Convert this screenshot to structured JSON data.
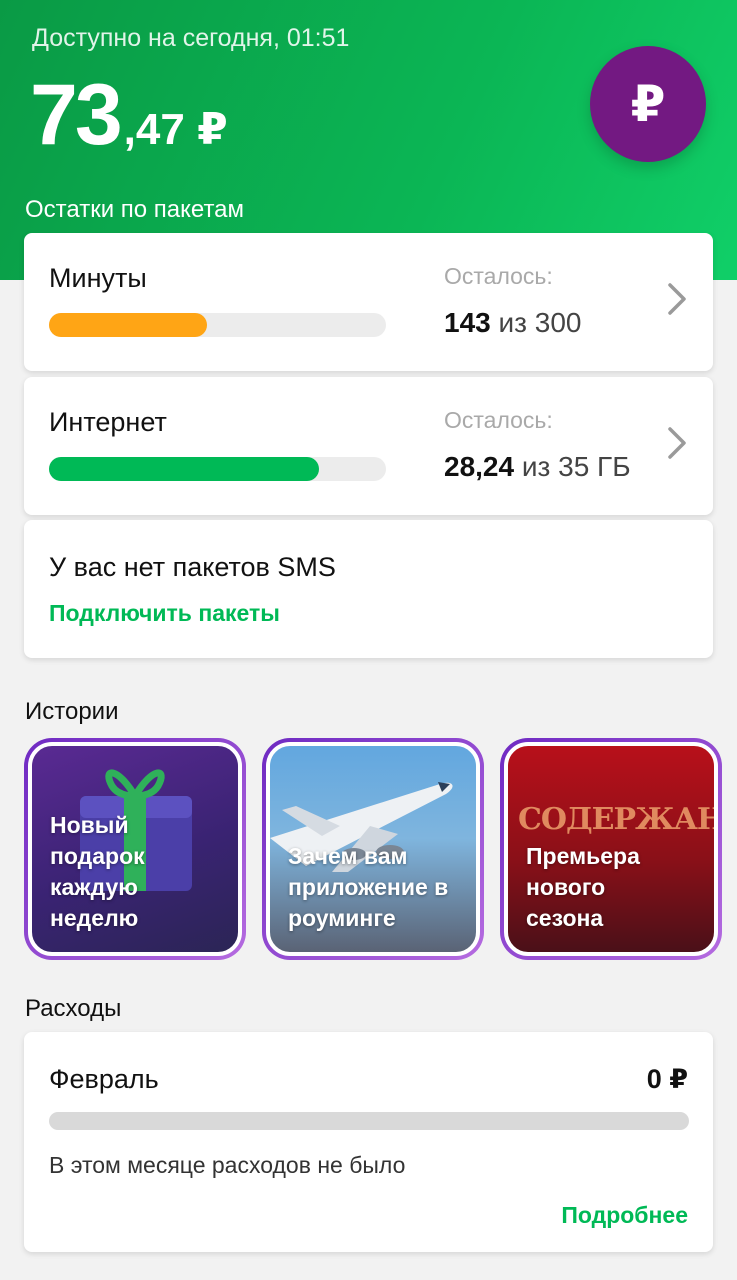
{
  "header": {
    "available_label": "Доступно на сегодня, 01:51",
    "balance_int": "73",
    "balance_frac": ",47 ₽",
    "rub_button_glyph": "₽",
    "accent_color": "#00b956",
    "brand_purple": "#731982"
  },
  "packages": {
    "title": "Остатки по пакетам",
    "items": [
      {
        "name": "Минуты",
        "remain_label": "Осталось:",
        "remain_value": "143",
        "remain_total": "из 300",
        "fill_fraction": 0.47,
        "color": "#ffa515",
        "icon": "chevron-right-icon"
      },
      {
        "name": "Интернет",
        "remain_label": "Осталось:",
        "remain_value": "28,24",
        "remain_total": "из 35 ГБ",
        "fill_fraction": 0.8,
        "color": "#00b956",
        "icon": "chevron-right-icon"
      }
    ],
    "sms": {
      "title": "У вас нет пакетов SMS",
      "link": "Подключить пакеты"
    }
  },
  "stories": {
    "title": "Истории",
    "items": [
      {
        "text_lines": [
          "Новый",
          "подарок",
          "каждую",
          "неделю"
        ],
        "icon": "gift-icon"
      },
      {
        "text_lines": [
          "Зачем вам",
          "приложение в",
          "роуминге"
        ],
        "icon": "airplane-icon"
      },
      {
        "text_lines": [
          "Премьера",
          "нового",
          "сезона"
        ],
        "poster_text": "СОДЕРЖАНКИ"
      }
    ]
  },
  "expenses": {
    "title": "Расходы",
    "month": "Февраль",
    "amount": "0 ₽",
    "note": "В этом месяце расходов не было",
    "more_link": "Подробнее"
  }
}
